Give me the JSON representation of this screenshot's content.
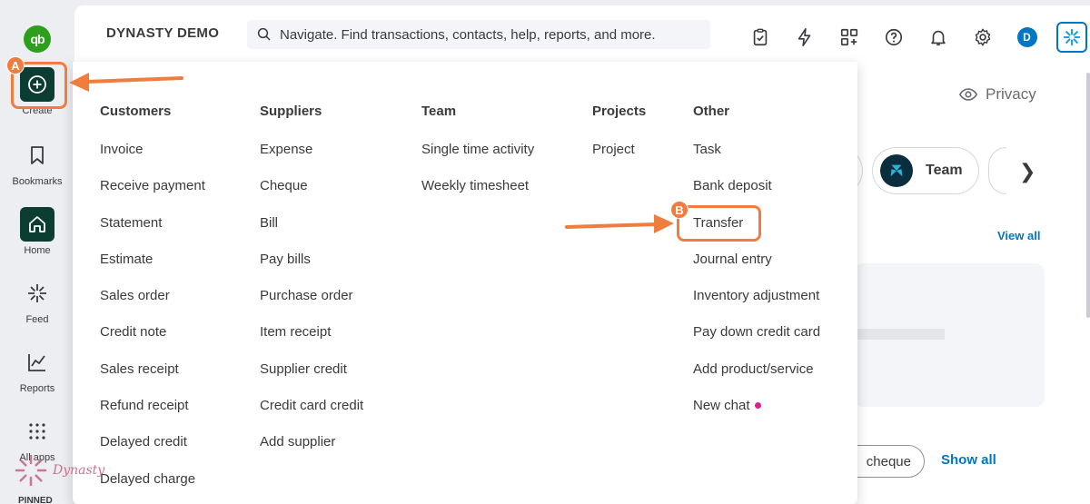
{
  "rail": {
    "create": "Create",
    "bookmarks": "Bookmarks",
    "home": "Home",
    "feed": "Feed",
    "reports": "Reports",
    "all_apps": "All apps",
    "pinned": "PINNED"
  },
  "topbar": {
    "company": "DYNASTY DEMO",
    "search_placeholder": "Navigate. Find transactions, contacts, help, reports, and more.",
    "avatar_initial": "D"
  },
  "page": {
    "privacy": "Privacy",
    "team_chip": "Team",
    "view_all": "View all",
    "cheque_button": "cheque",
    "show_all": "Show all"
  },
  "menu": {
    "columns": [
      {
        "heading": "Customers",
        "items": [
          "Invoice",
          "Receive payment",
          "Statement",
          "Estimate",
          "Sales order",
          "Credit note",
          "Sales receipt",
          "Refund receipt",
          "Delayed credit",
          "Delayed charge"
        ]
      },
      {
        "heading": "Suppliers",
        "items": [
          "Expense",
          "Cheque",
          "Bill",
          "Pay bills",
          "Purchase order",
          "Item receipt",
          "Supplier credit",
          "Credit card credit",
          "Add supplier"
        ]
      },
      {
        "heading": "Team",
        "items": [
          "Single time activity",
          "Weekly timesheet"
        ]
      },
      {
        "heading": "Projects",
        "items": [
          "Project"
        ]
      },
      {
        "heading": "Other",
        "items": [
          "Task",
          "Bank deposit",
          "Transfer",
          "Journal entry",
          "Inventory adjustment",
          "Pay down credit card",
          "Add product/service",
          "New chat"
        ]
      }
    ]
  },
  "annotations": {
    "badge_a": "A",
    "badge_b": "B",
    "color": "#f07c3e"
  },
  "watermark": {
    "text": "Dynasty"
  },
  "colors": {
    "brand_green": "#2ca01c",
    "dark_green": "#0b3d33",
    "link_blue": "#0077c5",
    "new_dot": "#e01f8e"
  }
}
